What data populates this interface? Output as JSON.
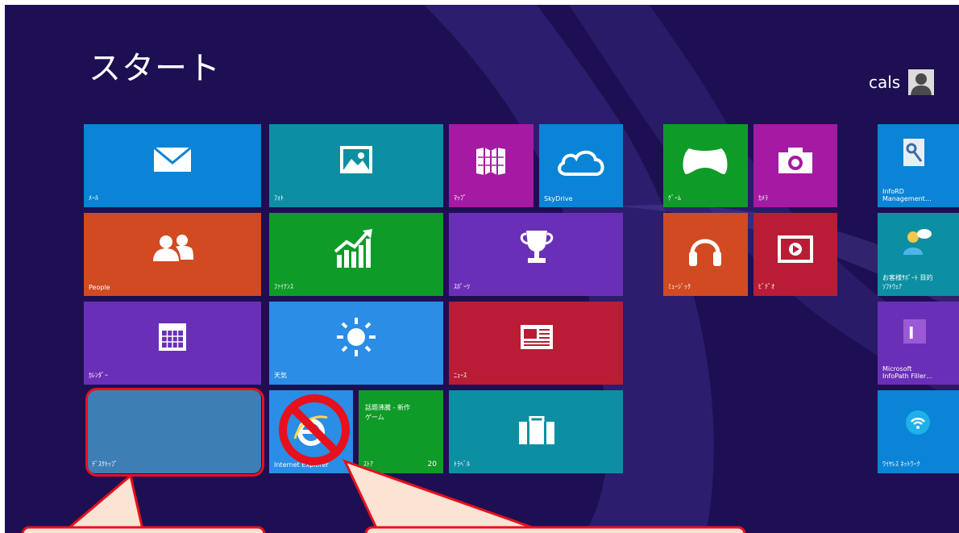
{
  "start": {
    "title": "スタート"
  },
  "user": {
    "name": "cals",
    "icon": "user-avatar-icon"
  },
  "colors": {
    "background": "#1e0f52",
    "blue": "#0a84d6",
    "teal": "#0d8fa3",
    "purple": "#6a2fb7",
    "orange": "#d14a21",
    "green": "#0f9b28",
    "red": "#b81d35",
    "highlight": "#e8101c",
    "callout_fill": "#fbe4d4"
  },
  "tiles": [
    {
      "id": "mail",
      "label": "ﾒｰﾙ",
      "icon": "mail-icon"
    },
    {
      "id": "photos",
      "label": "ﾌｫﾄ",
      "icon": "photo-icon"
    },
    {
      "id": "maps",
      "label": "ﾏｯﾌﾟ",
      "icon": "map-icon"
    },
    {
      "id": "skydrive",
      "label": "SkyDrive",
      "icon": "cloud-icon"
    },
    {
      "id": "people",
      "label": "People",
      "icon": "people-icon"
    },
    {
      "id": "finance",
      "label": "ﾌｧｲﾅﾝｽ",
      "icon": "chart-icon"
    },
    {
      "id": "sports",
      "label": "ｽﾎﾟｰﾂ",
      "icon": "trophy-icon"
    },
    {
      "id": "calendar",
      "label": "ｶﾚﾝﾀﾞｰ",
      "icon": "calendar-icon"
    },
    {
      "id": "weather",
      "label": "天気",
      "icon": "sun-icon"
    },
    {
      "id": "news",
      "label": "ﾆｭｰｽ",
      "icon": "newspaper-icon"
    },
    {
      "id": "desktop",
      "label": "ﾃﾞｽｸﾄｯﾌﾟ",
      "icon": ""
    },
    {
      "id": "ie",
      "label": "Internet Explorer",
      "icon": "internet-explorer-icon"
    },
    {
      "id": "store",
      "label": "ｽﾄｱ",
      "badge": "20",
      "headline": "話題沸騰 - 新作\nゲーム",
      "icon": ""
    },
    {
      "id": "travel",
      "label": "ﾄﾗﾍﾞﾙ",
      "icon": "briefcase-icon"
    },
    {
      "id": "games",
      "label": "ｹﾞｰﾑ",
      "icon": "game-controller-icon"
    },
    {
      "id": "camera",
      "label": "ｶﾒﾗ",
      "icon": "camera-icon"
    },
    {
      "id": "music",
      "label": "ﾐｭｰｼﾞｯｸ",
      "icon": "headphones-icon"
    },
    {
      "id": "video",
      "label": "ﾋﾞﾃﾞｵ",
      "icon": "video-icon"
    },
    {
      "id": "infopath-mgmt",
      "label": "InfoRD\nManagement…",
      "icon": "key-document-icon"
    },
    {
      "id": "remote-assist",
      "label": "お客様ｻﾎﾟｰﾄ 目的\nｿﾌﾄｳｪｱ",
      "icon": "remote-assistance-icon"
    },
    {
      "id": "infopath-filler",
      "label": "Microsoft\nInfoPath Filler…",
      "icon": "infopath-icon"
    },
    {
      "id": "wireless",
      "label": "ﾜｲﾔﾚｽ ﾈｯﾄﾜｰｸ",
      "icon": "wifi-icon"
    }
  ],
  "annotations": {
    "desktop_highlight": "desktop-tile-highlight",
    "ie_prohibited": "no-symbol-icon"
  }
}
